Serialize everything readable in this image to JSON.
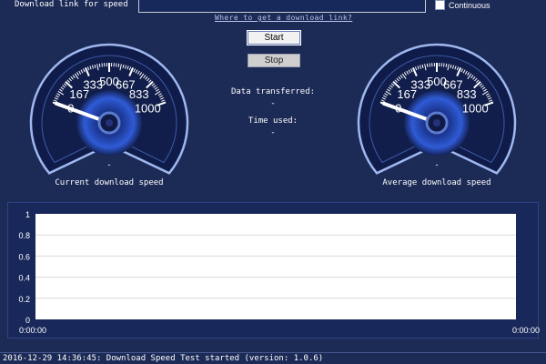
{
  "toolbar": {
    "url_label": "Download link for speed",
    "url_value": "",
    "url_hint": "Where to get a download link?",
    "continuous_label": "Continuous",
    "continuous_checked": false
  },
  "controls": {
    "start_label": "Start",
    "stop_label": "Stop"
  },
  "stats": {
    "data_transferred_label": "Data transferred:",
    "data_transferred_value": "-",
    "time_used_label": "Time used:",
    "time_used_value": "-"
  },
  "gauges": {
    "scale": {
      "min": 0,
      "max": 1000,
      "tick_labels": [
        "0",
        "167",
        "333",
        "500",
        "667",
        "833",
        "1000"
      ]
    },
    "current": {
      "title": "Current download speed",
      "value_text": "-",
      "needle_value": 0
    },
    "average": {
      "title": "Average download speed",
      "value_text": "-",
      "needle_value": 0
    }
  },
  "chart_data": {
    "type": "line",
    "title": "",
    "xlabel": "",
    "ylabel": "",
    "ylim": [
      0,
      1
    ],
    "y_ticks": [
      "0",
      "0.2",
      "0.4",
      "0.6",
      "0.8",
      "1"
    ],
    "x_tick_labels": [
      "0:00:00",
      "0:00:00"
    ],
    "grid": true,
    "series": [],
    "colors": {
      "plot_background": "#ffffff",
      "gridline": "#d9d9d9"
    }
  },
  "status": {
    "text": "2016-12-29 14:36:45: Download Speed Test started (version: 1.0.6)"
  },
  "colors": {
    "background": "#1c2a56",
    "gauge_face": "#132152",
    "gauge_glow": "#2f5bd6",
    "accent": "#9fb8ee"
  }
}
